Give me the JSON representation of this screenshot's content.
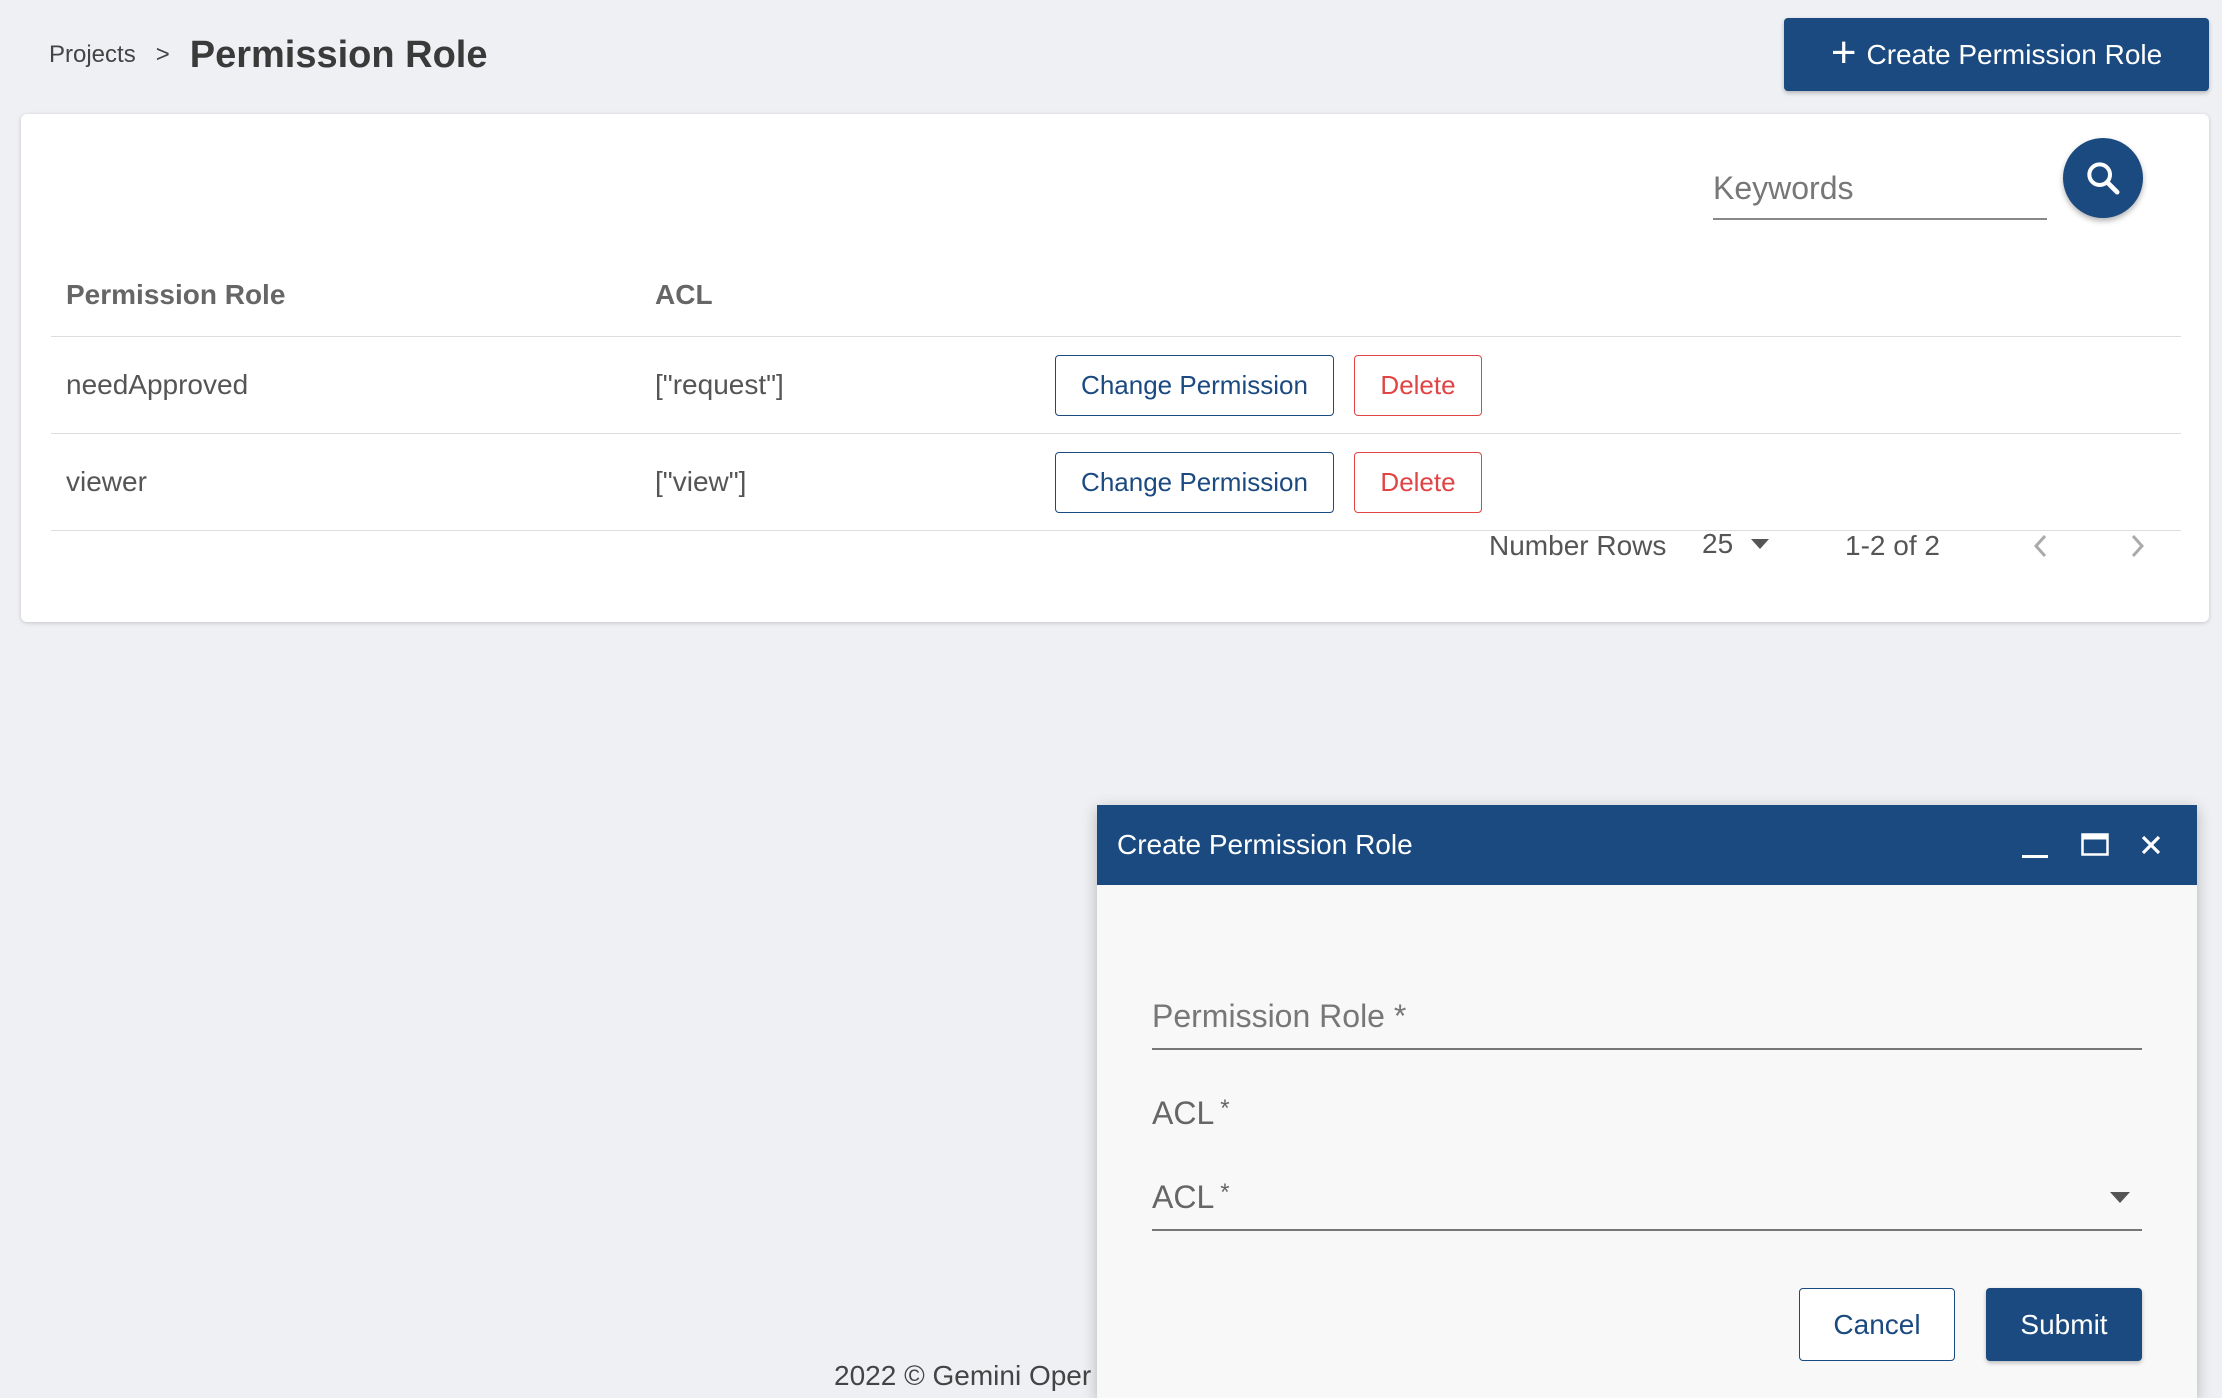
{
  "header": {
    "breadcrumb_link": "Projects",
    "breadcrumb_sep": ">",
    "title": "Permission Role",
    "create_button_label": "Create Permission Role"
  },
  "search": {
    "placeholder": "Keywords",
    "value": ""
  },
  "table": {
    "columns": [
      "Permission Role",
      "ACL"
    ],
    "rows": [
      {
        "role": "needApproved",
        "acl": "[\"request\"]",
        "change_label": "Change Permission",
        "delete_label": "Delete"
      },
      {
        "role": "viewer",
        "acl": "[\"view\"]",
        "change_label": "Change Permission",
        "delete_label": "Delete"
      }
    ]
  },
  "pagination": {
    "rows_label": "Number Rows",
    "rows_per_page": "25",
    "range": "1-2 of 2"
  },
  "footer": {
    "text": "2022 © Gemini Oper"
  },
  "dialog": {
    "title": "Create Permission Role",
    "role_field_placeholder": "Permission Role",
    "required_mark": "*",
    "acl_label": "ACL",
    "acl_select_placeholder": "ACL",
    "cancel_label": "Cancel",
    "submit_label": "Submit"
  },
  "colors": {
    "primary": "#1b4a80",
    "danger": "#e04444",
    "background": "#eef0f4"
  },
  "icons": [
    "plus-icon",
    "search-icon",
    "chevron-left-icon",
    "chevron-right-icon",
    "minimize-icon",
    "maximize-icon",
    "close-icon",
    "caret-down-icon"
  ]
}
